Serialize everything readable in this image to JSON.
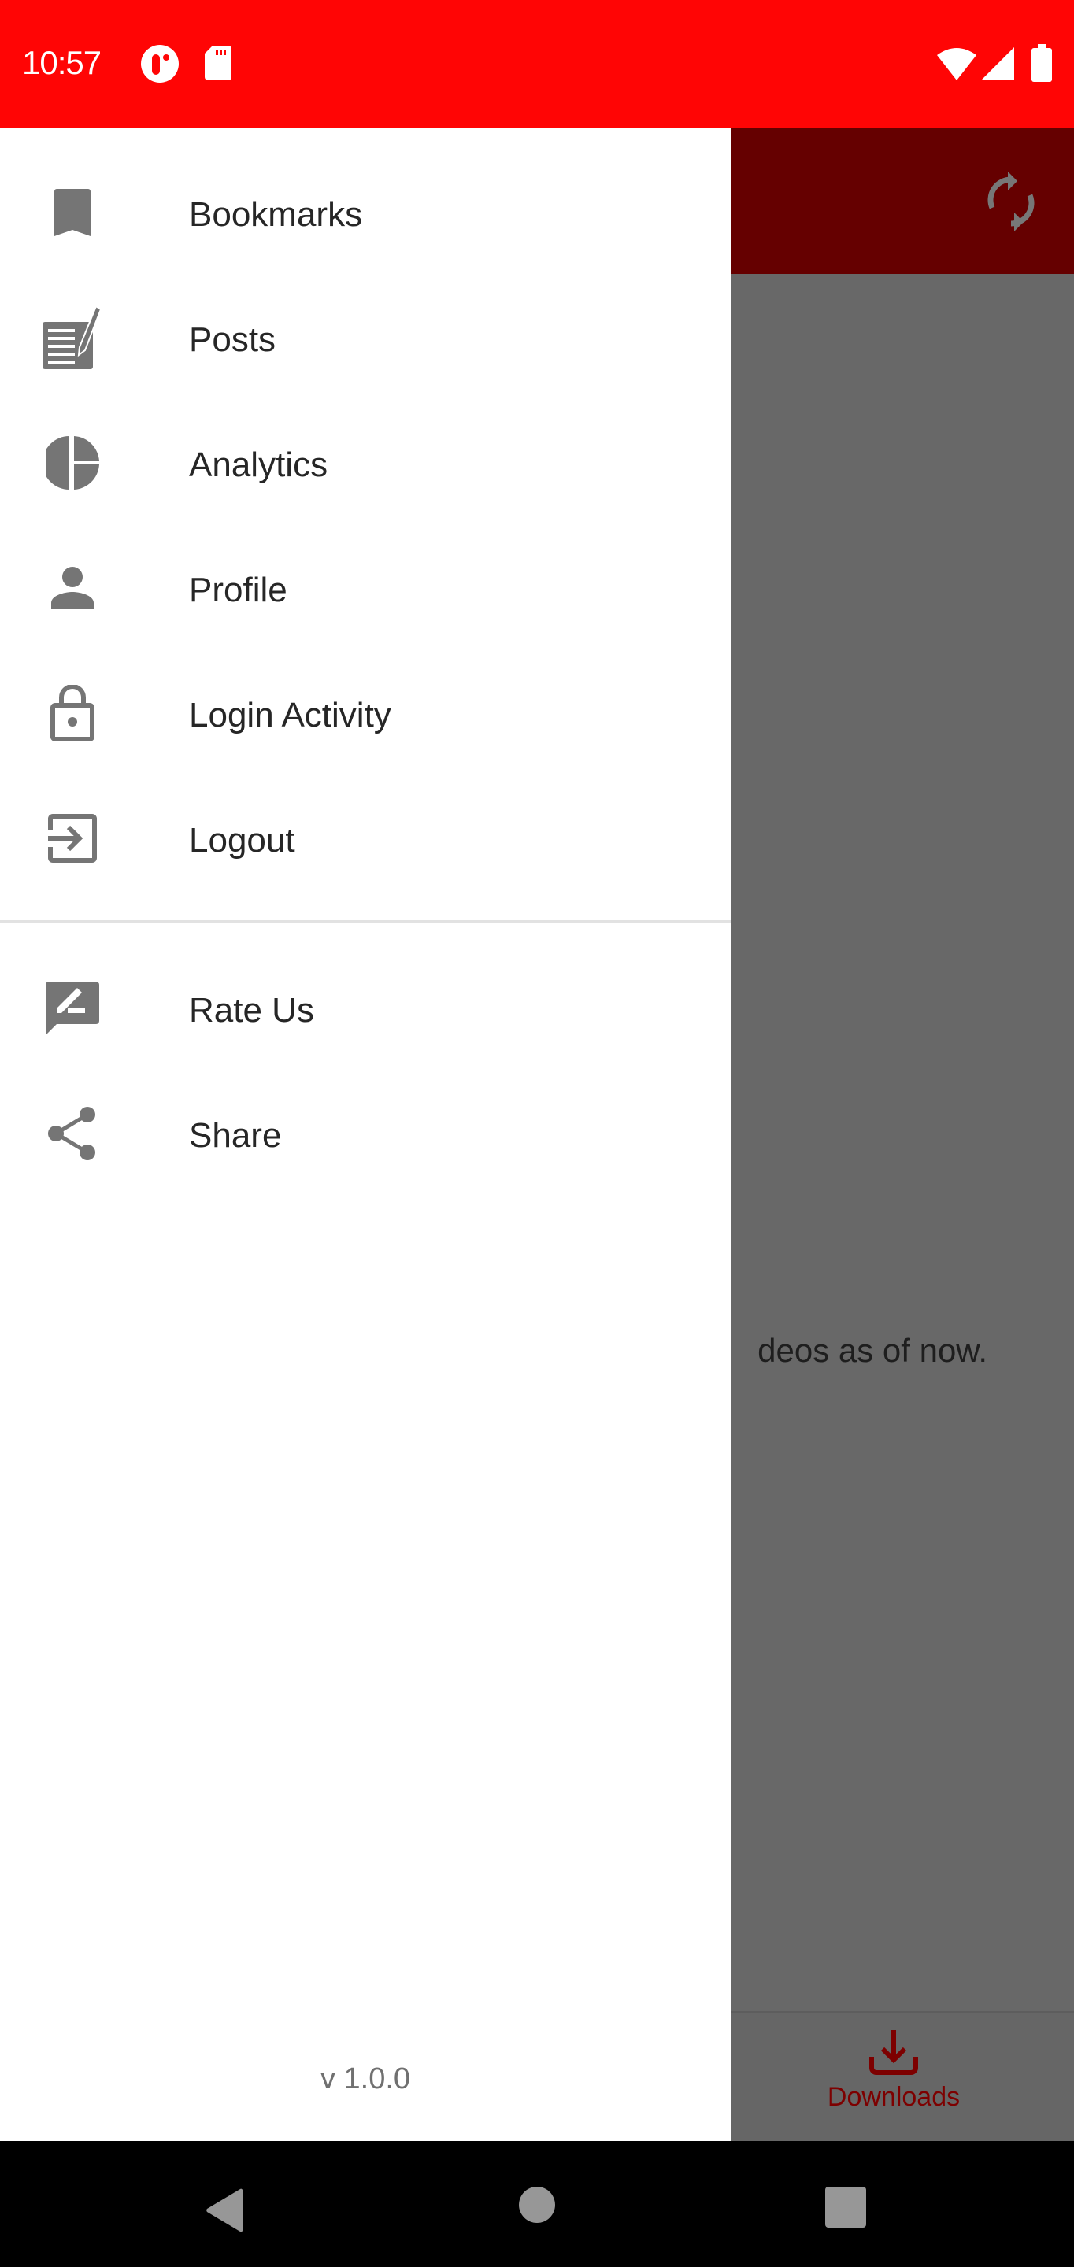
{
  "status_bar": {
    "time": "10:57",
    "left_icons": [
      "app-notification-icon",
      "sd-card-icon"
    ],
    "right_icons": [
      "wifi-icon",
      "cell-signal-icon",
      "battery-icon"
    ],
    "background_color": "#ff0505"
  },
  "app": {
    "toolbar": {
      "background_color": "#650000",
      "actions": [
        {
          "icon": "sync-icon"
        }
      ]
    },
    "empty_message_visible_fragment": "deos as of now.",
    "bottom_nav": {
      "tabs": [
        {
          "label": "Downloads",
          "icon": "download-icon",
          "color": "#7d0000"
        }
      ]
    }
  },
  "drawer": {
    "primary_items": [
      {
        "label": "Bookmarks",
        "icon": "bookmark-icon"
      },
      {
        "label": "Posts",
        "icon": "posts-icon"
      },
      {
        "label": "Analytics",
        "icon": "pie-chart-icon"
      },
      {
        "label": "Profile",
        "icon": "person-icon"
      },
      {
        "label": "Login Activity",
        "icon": "lock-icon"
      },
      {
        "label": "Logout",
        "icon": "logout-icon"
      }
    ],
    "secondary_items": [
      {
        "label": "Rate Us",
        "icon": "rate-review-icon"
      },
      {
        "label": "Share",
        "icon": "share-icon"
      }
    ],
    "version": "v 1.0.0",
    "icon_color": "#757575",
    "text_color": "#262626"
  },
  "system_nav": {
    "buttons": [
      "back",
      "home",
      "recents"
    ]
  }
}
